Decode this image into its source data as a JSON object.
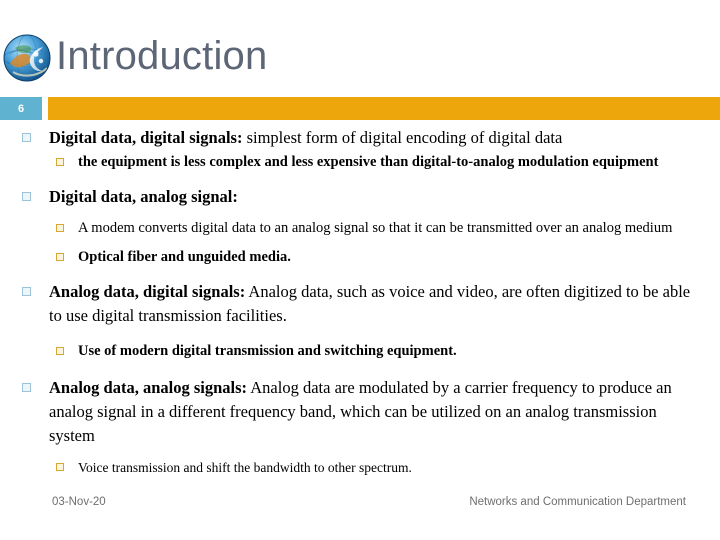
{
  "header": {
    "title": "Introduction",
    "logo_icon": "globe-network-icon",
    "slide_number": "6"
  },
  "theme": {
    "title_color": "#5d6676",
    "accent_bar_color": "#eda70c",
    "slide_number_box_color": "#5fb3d1",
    "level1_marker_color": "#9cc3d8",
    "level2_marker_color": "#d6a833",
    "body_text_color": "#000000",
    "footer_text_color": "#6e6e6e"
  },
  "body": {
    "bullets": [
      {
        "level": 1,
        "lead": "Digital data, digital signals:",
        "rest": " simplest form of digital encoding of digital data"
      },
      {
        "level": 2,
        "lead": "",
        "rest": "the equipment is less complex and less expensive than digital-to-analog modulation equipment"
      },
      {
        "level": 1,
        "lead": "Digital data, analog signal:",
        "rest": ""
      },
      {
        "level": 2,
        "lead": "",
        "rest": "A modem converts digital data to an analog signal so that it can be transmitted over an analog medium"
      },
      {
        "level": 2,
        "lead": "",
        "rest": "Optical fiber and unguided media."
      },
      {
        "level": 1,
        "lead": "Analog data, digital signals:",
        "rest": " Analog data, such as voice and video, are often digitized to be able to use digital transmission facilities."
      },
      {
        "level": 2,
        "lead": "",
        "rest": "Use of modern digital transmission and switching equipment."
      },
      {
        "level": 1,
        "lead": "Analog data, analog signals:",
        "rest": " Analog data are modulated by a carrier frequency to produce an analog signal in a different frequency band, which can be utilized on an analog transmission system"
      },
      {
        "level": 2,
        "lead": "",
        "rest": "Voice transmission and shift the bandwidth to other spectrum."
      }
    ]
  },
  "footer": {
    "date": "03-Nov-20",
    "department": "Networks and Communication Department"
  }
}
